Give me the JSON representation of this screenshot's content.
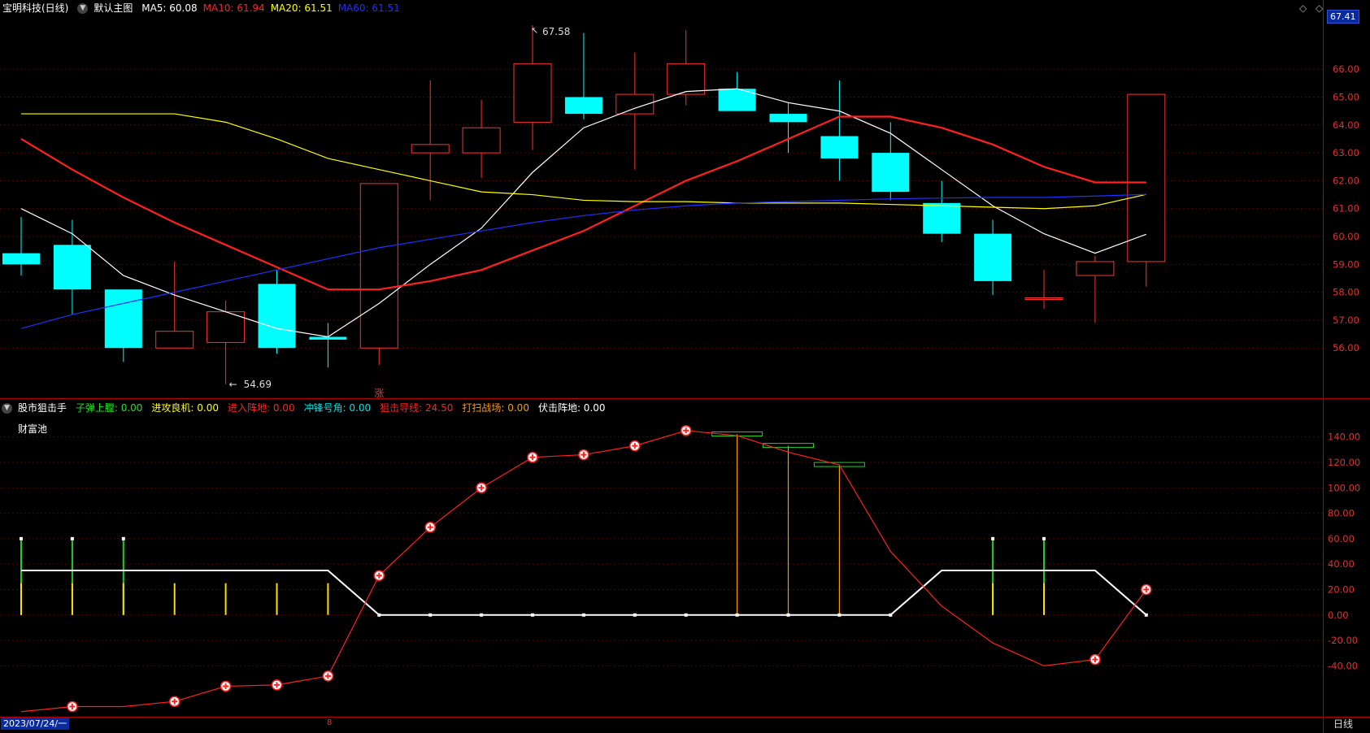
{
  "main_panel": {
    "stock_name": "宝明科技(日线)",
    "template_label": "默认主图",
    "ma": [
      {
        "label": "MA5: 60.08",
        "color": "#ffffff"
      },
      {
        "label": "MA10: 61.94",
        "color": "#ff2020"
      },
      {
        "label": "MA20: 61.51",
        "color": "#ffff00"
      },
      {
        "label": "MA60: 61.51",
        "color": "#2030ff"
      }
    ],
    "current_price_tag": "67.41",
    "high_marker": "67.58",
    "low_marker": "54.69",
    "signal_char": "涨"
  },
  "sub_panel": {
    "indicator_name": "股市狙击手",
    "fields": [
      {
        "label": "子弹上膛: 0.00",
        "color": "#20e020"
      },
      {
        "label": "进攻良机: 0.00",
        "color": "#ffff00"
      },
      {
        "label": "进入阵地: 0.00",
        "color": "#ff2020"
      },
      {
        "label": "冲锋号角: 0.00",
        "color": "#00e0e0"
      },
      {
        "label": "狙击导线: 24.50",
        "color": "#ff2020"
      },
      {
        "label": "打扫战场: 0.00",
        "color": "#ff9900"
      },
      {
        "label": "伏击阵地: 0.00",
        "color": "#ffffff"
      }
    ],
    "pool_label": "财富池"
  },
  "bottom_bar": {
    "date": "2023/07/24/一",
    "period_tab": "日线",
    "marker": "8"
  },
  "chart_data": [
    {
      "type": "candlestick",
      "title": "宝明科技(日线)",
      "y_ticks": [
        56,
        57,
        58,
        59,
        60,
        61,
        62,
        63,
        64,
        65,
        66
      ],
      "y_tick_labels": [
        "56.00",
        "57.00",
        "58.00",
        "59.00",
        "60.00",
        "61.00",
        "62.00",
        "63.00",
        "64.00",
        "65.00",
        "66.00"
      ],
      "ylim": [
        54.2,
        67.9
      ],
      "candles": [
        {
          "o": 59.4,
          "c": 59.0,
          "h": 60.7,
          "l": 58.6
        },
        {
          "o": 59.7,
          "c": 58.1,
          "h": 60.6,
          "l": 57.2
        },
        {
          "o": 58.1,
          "c": 56.0,
          "h": 58.1,
          "l": 55.5
        },
        {
          "o": 56.0,
          "c": 56.6,
          "h": 59.1,
          "l": 56.0
        },
        {
          "o": 56.2,
          "c": 57.3,
          "h": 57.7,
          "l": 54.7
        },
        {
          "o": 58.3,
          "c": 56.0,
          "h": 58.8,
          "l": 55.8
        },
        {
          "o": 56.4,
          "c": 56.3,
          "h": 56.9,
          "l": 55.3
        },
        {
          "o": 56.0,
          "c": 61.9,
          "h": 61.9,
          "l": 55.4
        },
        {
          "o": 63.0,
          "c": 63.3,
          "h": 65.6,
          "l": 61.3
        },
        {
          "o": 63.0,
          "c": 63.9,
          "h": 64.9,
          "l": 62.1
        },
        {
          "o": 64.1,
          "c": 66.2,
          "h": 67.58,
          "l": 63.1
        },
        {
          "o": 65.0,
          "c": 64.4,
          "h": 67.3,
          "l": 64.2
        },
        {
          "o": 64.4,
          "c": 65.1,
          "h": 66.6,
          "l": 62.4
        },
        {
          "o": 65.1,
          "c": 66.2,
          "h": 67.4,
          "l": 64.7
        },
        {
          "o": 65.3,
          "c": 64.5,
          "h": 65.9,
          "l": 64.5
        },
        {
          "o": 64.4,
          "c": 64.1,
          "h": 64.8,
          "l": 63.0
        },
        {
          "o": 63.6,
          "c": 62.8,
          "h": 65.6,
          "l": 62.0
        },
        {
          "o": 63.0,
          "c": 61.6,
          "h": 64.1,
          "l": 61.3
        },
        {
          "o": 61.2,
          "c": 60.1,
          "h": 62.0,
          "l": 59.8
        },
        {
          "o": 60.1,
          "c": 58.4,
          "h": 60.6,
          "l": 57.9
        },
        {
          "o": 57.8,
          "c": 57.8,
          "h": 58.8,
          "l": 57.4
        },
        {
          "o": 58.6,
          "c": 59.1,
          "h": 59.3,
          "l": 56.9
        },
        {
          "o": 59.1,
          "c": 65.1,
          "h": 65.1,
          "l": 58.2
        }
      ],
      "series": [
        {
          "name": "MA5",
          "color": "#ffffff",
          "values": [
            61.0,
            60.1,
            58.6,
            57.9,
            57.3,
            56.7,
            56.4,
            57.6,
            59.0,
            60.3,
            62.3,
            63.9,
            64.6,
            65.2,
            65.3,
            64.8,
            64.5,
            63.7,
            62.4,
            61.1,
            60.1,
            59.4,
            60.08
          ]
        },
        {
          "name": "MA10",
          "color": "#ff2020",
          "values": [
            63.5,
            62.4,
            61.4,
            60.5,
            59.7,
            58.9,
            58.1,
            58.1,
            58.4,
            58.8,
            59.5,
            60.2,
            61.1,
            62.0,
            62.7,
            63.5,
            64.3,
            64.3,
            63.9,
            63.3,
            62.5,
            61.94,
            61.94
          ]
        },
        {
          "name": "MA20",
          "color": "#ffff00",
          "values": [
            64.4,
            64.4,
            64.4,
            64.4,
            64.1,
            63.5,
            62.8,
            62.4,
            62.0,
            61.6,
            61.5,
            61.3,
            61.25,
            61.25,
            61.2,
            61.2,
            61.2,
            61.15,
            61.1,
            61.05,
            61.0,
            61.1,
            61.51
          ]
        },
        {
          "name": "MA60",
          "color": "#2030ff",
          "values": [
            56.7,
            57.2,
            57.6,
            58.0,
            58.4,
            58.8,
            59.2,
            59.6,
            59.9,
            60.2,
            60.5,
            60.75,
            60.95,
            61.1,
            61.2,
            61.25,
            61.3,
            61.35,
            61.38,
            61.4,
            61.4,
            61.45,
            61.51
          ]
        }
      ]
    },
    {
      "type": "line",
      "title": "股市狙击手",
      "y_tick_labels": [
        "-40.00",
        "-20.00",
        "0.00",
        "20.00",
        "40.00",
        "60.00",
        "80.00",
        "100.00",
        "120.00",
        "140.00"
      ],
      "y_ticks": [
        -40,
        -20,
        0,
        20,
        40,
        60,
        80,
        100,
        120,
        140
      ],
      "ylim": [
        -80,
        150
      ],
      "series": [
        {
          "name": "狙击导线",
          "color": "#ff2020",
          "values": [
            -76,
            -72,
            -72,
            -68,
            -56,
            -55,
            -48,
            31,
            69,
            100,
            124,
            126,
            133,
            145,
            141,
            128,
            118,
            50,
            7,
            -22,
            -40,
            -35,
            20
          ]
        },
        {
          "name": "伏击阵地",
          "color": "#ffffff",
          "values": [
            35,
            35,
            35,
            35,
            35,
            35,
            35,
            0,
            0,
            0,
            0,
            0,
            0,
            0,
            0,
            0,
            0,
            0,
            35,
            35,
            35,
            35,
            0
          ]
        }
      ],
      "green_bars": [
        60,
        60,
        60,
        0,
        0,
        0,
        0,
        0,
        0,
        0,
        0,
        0,
        0,
        0,
        0,
        0,
        0,
        0,
        0,
        60,
        60,
        0,
        0
      ],
      "yellow_bars": [
        25,
        25,
        25,
        25,
        25,
        25,
        25,
        0,
        0,
        0,
        0,
        0,
        0,
        0,
        0,
        0,
        0,
        0,
        0,
        25,
        25,
        0,
        0
      ],
      "orange_bars": [
        0,
        0,
        0,
        0,
        0,
        0,
        0,
        0,
        0,
        0,
        0,
        0,
        0,
        0,
        142,
        133,
        118,
        0,
        0,
        0,
        0,
        0,
        0
      ],
      "plus_markers_idx": [
        1,
        3,
        4,
        5,
        6,
        7,
        8,
        9,
        10,
        11,
        12,
        13,
        21,
        22
      ]
    }
  ]
}
